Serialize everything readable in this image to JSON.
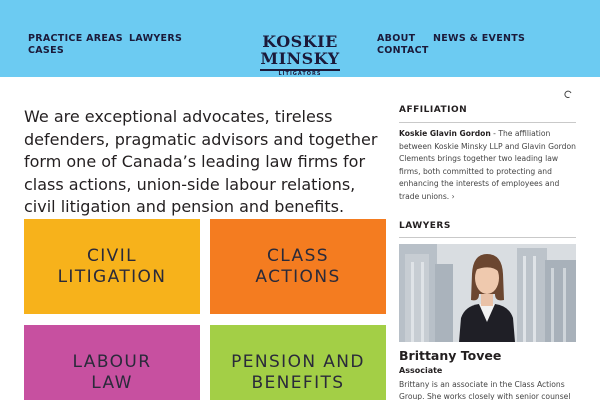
{
  "colors": {
    "header_bg": "#6ccbf2",
    "nav_text": "#1b1a3a",
    "civil": "#f7b21b",
    "class": "#f47c20",
    "labour": "#c750a0",
    "pension": "#a3cf46"
  },
  "header": {
    "nav_left": {
      "practice_areas": "PRACTICE AREAS",
      "cases": "CASES",
      "lawyers": "LAWYERS"
    },
    "nav_right": {
      "about": "ABOUT",
      "contact": "CONTACT",
      "news_events": "NEWS & EVENTS"
    },
    "logo": {
      "line1": "KOSKIE",
      "line2": "MINSKY",
      "tagline": "LITIGATORS"
    },
    "search_icon": "search-icon"
  },
  "intro": "We are exceptional advocates, tireless defenders, pragmatic advisors and together form one of Canada’s leading law firms for class actions, union-side labour relations, civil litigation and pension and benefits.",
  "tiles": {
    "civil": {
      "line1": "CIVIL",
      "line2": "LITIGATION"
    },
    "class": {
      "line1": "CLASS",
      "line2": "ACTIONS"
    },
    "labour": {
      "line1": "LABOUR",
      "line2": "LAW"
    },
    "pension": {
      "line1": "PENSION AND",
      "line2": "BENEFITS"
    }
  },
  "sidebar": {
    "affiliation": {
      "heading": "AFFILIATION",
      "org": "Koskie Glavin Gordon",
      "text": " - The affiliation between Koskie Minsky LLP and Glavin Gordon Clements brings together two leading law firms, both committed to protecting and enhancing the interests of employees and trade unions.",
      "more": " ›"
    },
    "lawyers": {
      "heading": "LAWYERS",
      "name": "Brittany Tovee",
      "title": "Associate",
      "bio": "Brittany is an associate in the Class Actions Group. She works closely with senior counsel"
    }
  }
}
